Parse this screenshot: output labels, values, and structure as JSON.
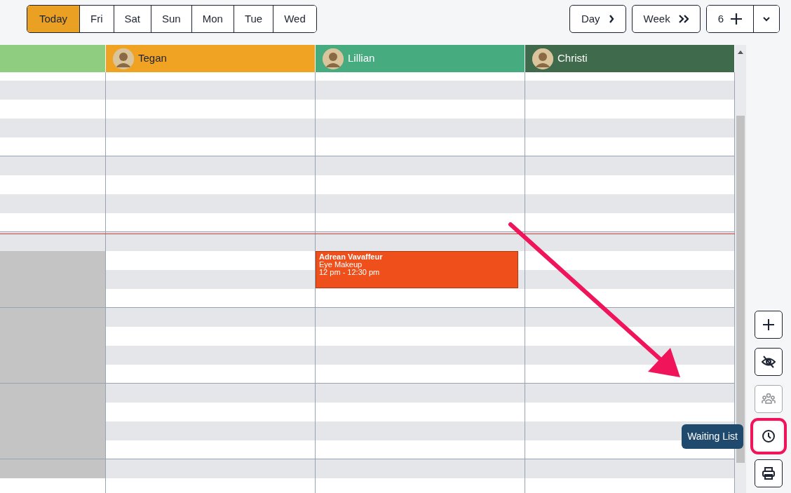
{
  "day_tabs": [
    {
      "label": "Today",
      "selected": true
    },
    {
      "label": "Fri",
      "selected": false
    },
    {
      "label": "Sat",
      "selected": false
    },
    {
      "label": "Sun",
      "selected": false
    },
    {
      "label": "Mon",
      "selected": false
    },
    {
      "label": "Tue",
      "selected": false
    },
    {
      "label": "Wed",
      "selected": false
    }
  ],
  "view_buttons": [
    {
      "label": "Day",
      "kind": "single"
    },
    {
      "label": "Week",
      "kind": "double"
    }
  ],
  "staff_count": {
    "label": "6"
  },
  "columns": [
    {
      "color": "#8fce81",
      "blocked_after_now": true
    },
    {
      "name": "Tegan",
      "color": "#f0a323"
    },
    {
      "name": "Lillian",
      "color": "#47ab80",
      "appointments": [
        {
          "client": "Adrean Vavaffeur",
          "service": "Eye Makeup",
          "time": "12 pm - 12:30 pm",
          "color": "#ef4f1a"
        }
      ]
    },
    {
      "name": "Christi",
      "color": "#3f6b4c"
    }
  ],
  "current_time_line": true,
  "side_buttons": [
    {
      "kind": "add",
      "disabled": false,
      "highlighted": false
    },
    {
      "kind": "hide",
      "disabled": false,
      "highlighted": false
    },
    {
      "kind": "group",
      "disabled": true,
      "highlighted": false
    },
    {
      "kind": "clock",
      "disabled": false,
      "highlighted": true,
      "tooltip": "Waiting List"
    },
    {
      "kind": "print",
      "disabled": false,
      "highlighted": false
    }
  ],
  "annotation_arrow": true
}
